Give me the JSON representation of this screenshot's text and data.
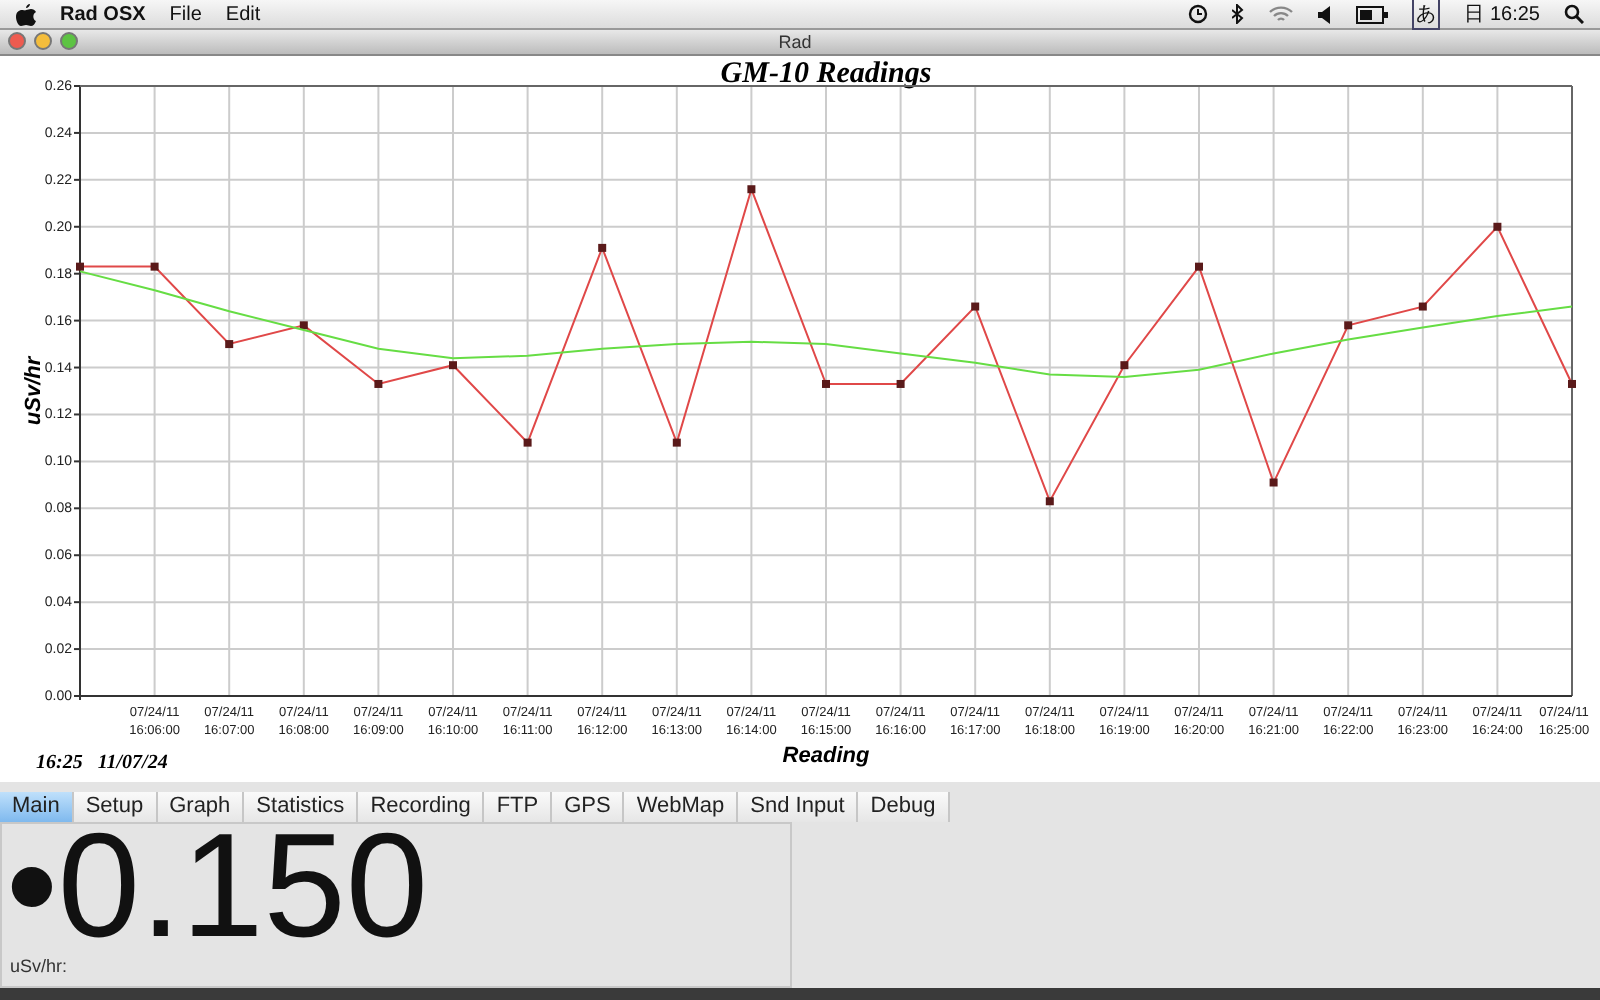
{
  "menu_bar": {
    "app_name": "Rad OSX",
    "menus": [
      "File",
      "Edit"
    ],
    "input_method": "あ",
    "clock": "日 16:25"
  },
  "window": {
    "title": "Rad"
  },
  "graph": {
    "timestamp": "16:25   11/07/24",
    "chart_data": {
      "type": "line",
      "title": "GM-10 Readings",
      "xlabel": "Reading",
      "ylabel": "uSv/hr",
      "categories": [
        null,
        "07/24/11 16:06:00",
        "07/24/11 16:07:00",
        "07/24/11 16:08:00",
        "07/24/11 16:09:00",
        "07/24/11 16:10:00",
        "07/24/11 16:11:00",
        "07/24/11 16:12:00",
        "07/24/11 16:13:00",
        "07/24/11 16:14:00",
        "07/24/11 16:15:00",
        "07/24/11 16:16:00",
        "07/24/11 16:17:00",
        "07/24/11 16:18:00",
        "07/24/11 16:19:00",
        "07/24/11 16:20:00",
        "07/24/11 16:21:00",
        "07/24/11 16:22:00",
        "07/24/11 16:23:00",
        "07/24/11 16:24:00",
        "07/24/11 16:25:00"
      ],
      "ylim": [
        0,
        0.26
      ],
      "grid": true,
      "yticks": [
        {
          "value": 0,
          "label": "0.00"
        },
        {
          "value": 0.02,
          "label": "0.02"
        },
        {
          "value": 0.04,
          "label": "0.04"
        },
        {
          "value": 0.06,
          "label": "0.06"
        },
        {
          "value": 0.08,
          "label": "0.08"
        },
        {
          "value": 0.1,
          "label": "0.10"
        },
        {
          "value": 0.12,
          "label": "0.12"
        },
        {
          "value": 0.14,
          "label": "0.14"
        },
        {
          "value": 0.16,
          "label": "0.16"
        },
        {
          "value": 0.18,
          "label": "0.18"
        },
        {
          "value": 0.2,
          "label": "0.20"
        },
        {
          "value": 0.22,
          "label": "0.22"
        },
        {
          "value": 0.24,
          "label": "0.24"
        },
        {
          "value": 0.26,
          "label": "0.26"
        }
      ],
      "series": [
        {
          "color": "#e04848",
          "marker": "square",
          "values": [
            0.183,
            0.183,
            0.15,
            0.158,
            0.133,
            0.141,
            0.108,
            0.191,
            0.108,
            0.216,
            0.133,
            0.133,
            0.166,
            0.083,
            0.141,
            0.183,
            0.091,
            0.158,
            0.166,
            0.2,
            0.133
          ]
        },
        {
          "color": "#66dd44",
          "values": [
            0.181,
            0.173,
            0.164,
            0.156,
            0.148,
            0.144,
            0.145,
            0.148,
            0.15,
            0.151,
            0.15,
            0.146,
            0.142,
            0.137,
            0.136,
            0.139,
            0.146,
            0.152,
            0.157,
            0.162,
            0.166
          ]
        }
      ]
    }
  },
  "tabs": [
    {
      "label": "Main",
      "selected": true
    },
    {
      "label": "Setup",
      "selected": false
    },
    {
      "label": "Graph",
      "selected": false
    },
    {
      "label": "Statistics",
      "selected": false
    },
    {
      "label": "Recording",
      "selected": false
    },
    {
      "label": "FTP",
      "selected": false
    },
    {
      "label": "GPS",
      "selected": false
    },
    {
      "label": "WebMap",
      "selected": false
    },
    {
      "label": "Snd Input",
      "selected": false
    },
    {
      "label": "Debug",
      "selected": false
    }
  ],
  "main_panel": {
    "reading": "•0.150",
    "unit_label": "uSv/hr:"
  }
}
